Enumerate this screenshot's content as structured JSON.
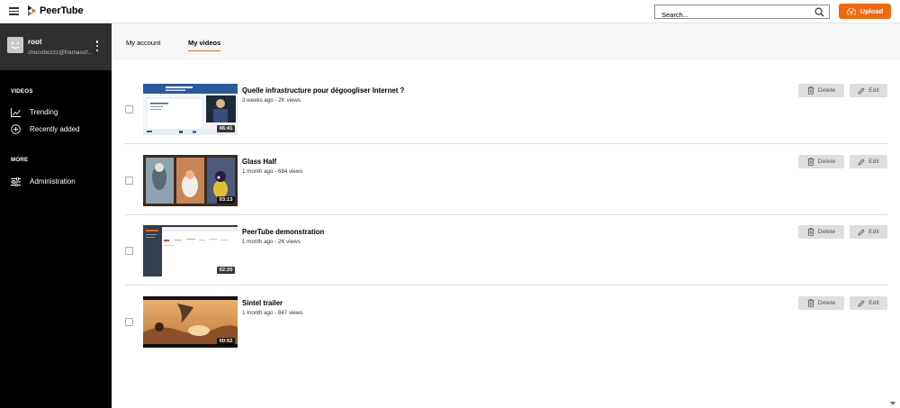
{
  "app": {
    "name": "PeerTube",
    "brand_color": "#f1680d"
  },
  "header": {
    "search_placeholder": "Search...",
    "upload_label": "Upload"
  },
  "sidebar": {
    "user": {
      "name": "root",
      "email": "chocobozzz@framasof..."
    },
    "sections": [
      {
        "title": "VIDEOS",
        "items": [
          {
            "label": "Trending",
            "icon": "trending-icon"
          },
          {
            "label": "Recently added",
            "icon": "plus-circle-icon"
          }
        ]
      },
      {
        "title": "MORE",
        "items": [
          {
            "label": "Administration",
            "icon": "sliders-icon"
          }
        ]
      }
    ]
  },
  "subnav": {
    "tabs": [
      {
        "label": "My account",
        "active": false
      },
      {
        "label": "My videos",
        "active": true
      }
    ]
  },
  "videos": [
    {
      "title": "Quelle infrastructure pour dégoogliser Internet ?",
      "meta": "3 weeks ago - 2K views",
      "duration": "46:41"
    },
    {
      "title": "Glass Half",
      "meta": "1 month ago - 684 views",
      "duration": "03:13"
    },
    {
      "title": "PeerTube demonstration",
      "meta": "1 month ago - 2K views",
      "duration": "02:20"
    },
    {
      "title": "Sintel trailer",
      "meta": "1 month ago - 847 views",
      "duration": "00:52"
    }
  ],
  "actions": {
    "delete_label": "Delete",
    "edit_label": "Edit"
  }
}
